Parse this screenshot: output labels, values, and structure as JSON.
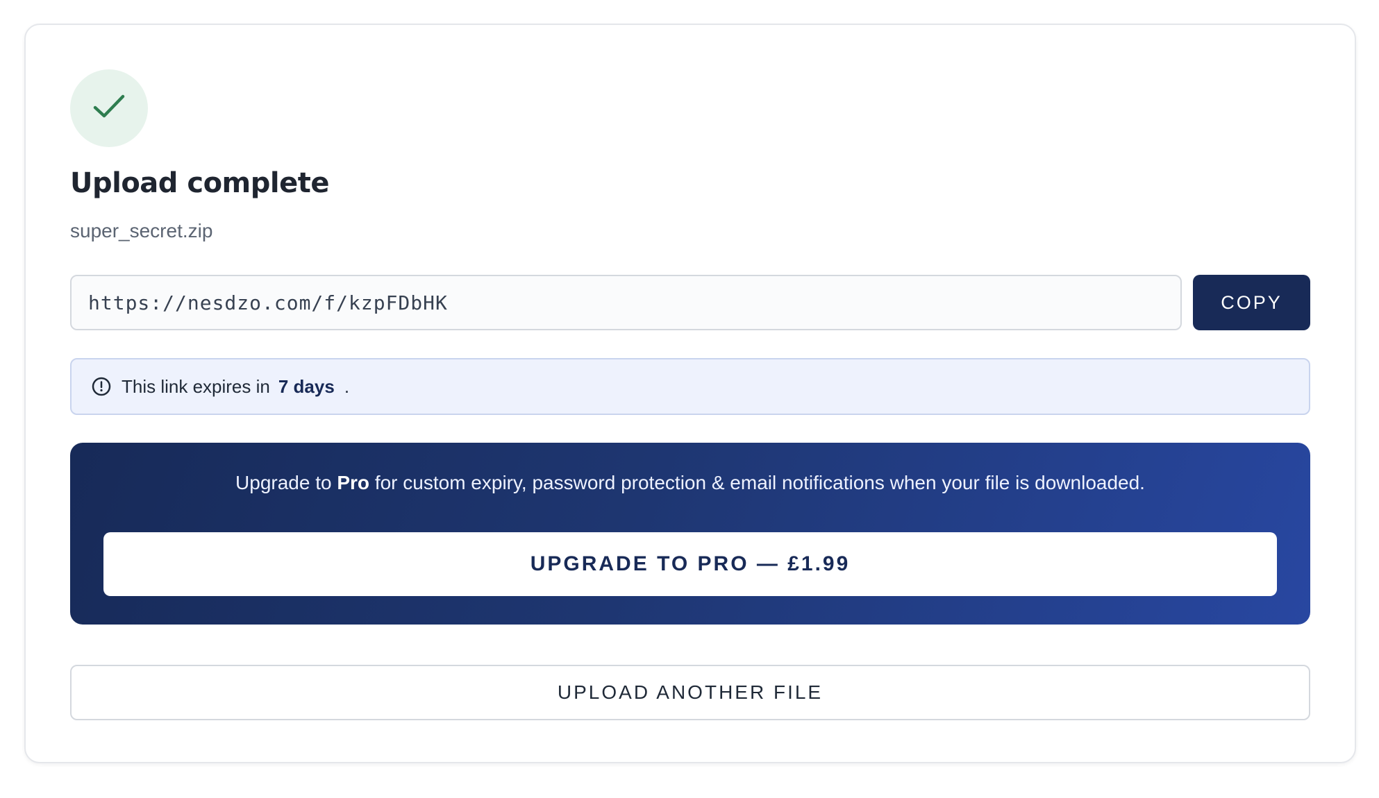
{
  "status": {
    "title": "Upload complete",
    "filename": "super_secret.zip",
    "icon": "check-icon",
    "accent_color": "#2e7d4f"
  },
  "share": {
    "link_value": "https://nesdzo.com/f/kzpFDbHK",
    "copy_label": "COPY"
  },
  "expiry": {
    "icon": "clock-icon",
    "prefix": "This link expires in",
    "duration": "7 days",
    "suffix": "."
  },
  "promo": {
    "text_before": "Upgrade to ",
    "text_bold": "Pro",
    "text_after": " for custom expiry, password protection & email notifications when your file is downloaded.",
    "button_label": "UPGRADE TO PRO — £1.99",
    "gradient_start": "#172a58",
    "gradient_end": "#2847a1"
  },
  "actions": {
    "upload_another_label": "UPLOAD ANOTHER FILE"
  }
}
